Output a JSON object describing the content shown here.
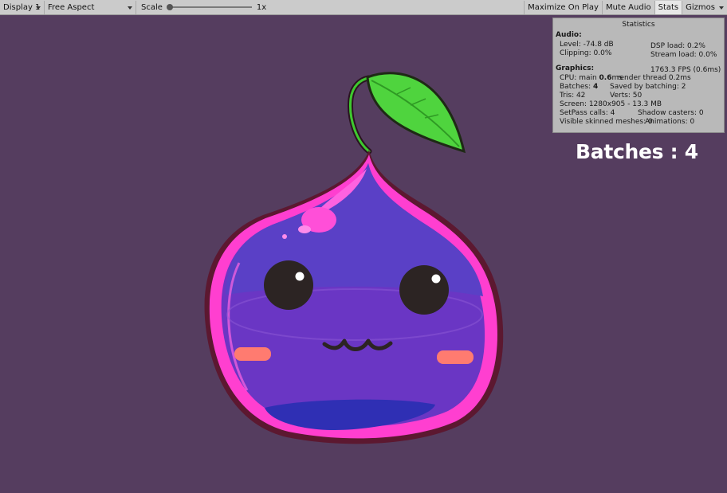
{
  "toolbar": {
    "display": "Display 1",
    "aspect": "Free Aspect",
    "scale_label": "Scale",
    "scale_value": "1x",
    "maximize": "Maximize On Play",
    "mute": "Mute Audio",
    "stats": "Stats",
    "gizmos": "Gizmos"
  },
  "stats": {
    "title": "Statistics",
    "audio_heading": "Audio:",
    "level": "Level: -74.8 dB",
    "clipping": "Clipping: 0.0%",
    "dsp_load": "DSP load: 0.2%",
    "stream_load": "Stream load: 0.0%",
    "graphics_heading": "Graphics:",
    "fps": "1763.3 FPS (0.6ms)",
    "cpu_main_label": "CPU: main ",
    "cpu_main_value": "0.6",
    "cpu_main_unit": "ms",
    "render_thread": "render thread 0.2ms",
    "batches_label": "Batches: ",
    "batches_value": "4",
    "saved_by_batching": "Saved by batching: 2",
    "tris": "Tris: 42",
    "verts": "Verts: 50",
    "screen": "Screen: 1280x905 - 13.3 MB",
    "setpass": "SetPass calls: 4",
    "shadow_casters": "Shadow casters: 0",
    "skinned_meshes": "Visible skinned meshes: 0",
    "animations": "Animations: 0"
  },
  "overlay": {
    "batches_text": "Batches : 4"
  },
  "colors": {
    "background": "#553d5f",
    "body": "#6a36c4",
    "rim": "#ff3fd0",
    "leaf": "#4fd43e",
    "cheek": "#ff7b70",
    "bottom": "#2f2fb4"
  }
}
